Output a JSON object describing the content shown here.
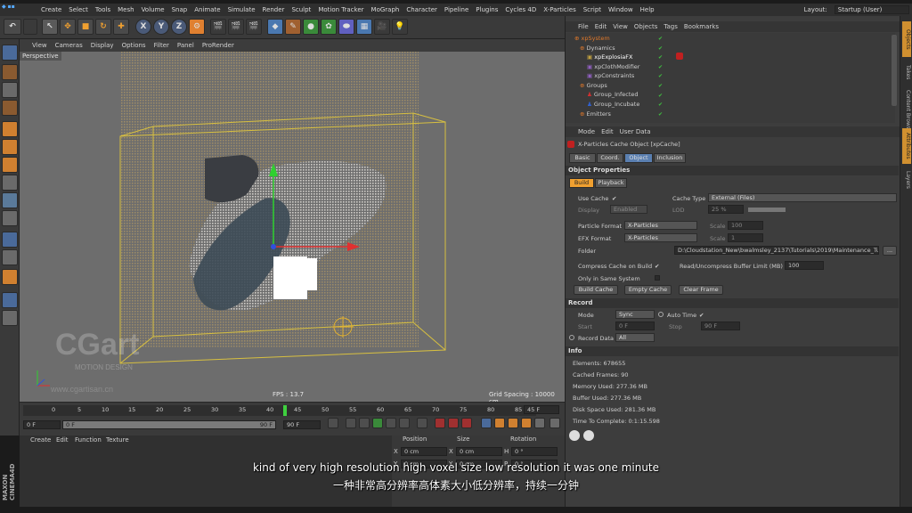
{
  "window_title": "CINEMA 4D",
  "menubar": {
    "items": [
      "Create",
      "Select",
      "Tools",
      "Mesh",
      "Volume",
      "Snap",
      "Animate",
      "Simulate",
      "Render",
      "Sculpt",
      "Motion Tracker",
      "MoGraph",
      "Character",
      "Pipeline",
      "Plugins",
      "Cycles 4D",
      "X-Particles",
      "Script",
      "Window",
      "Help"
    ],
    "layout_label": "Layout:",
    "layout_value": "Startup (User)"
  },
  "toolbar": {
    "x_label": "X",
    "y_label": "Y",
    "z_label": "Z"
  },
  "viewport": {
    "menu": [
      "View",
      "Cameras",
      "Display",
      "Options",
      "Filter",
      "Panel",
      "ProRender"
    ],
    "label": "Perspective",
    "fps": "FPS : 13.7",
    "grid_spacing": "Grid Spacing : 10000 cm",
    "watermark_big": "CGart",
    "watermark_small": "MOTION DESIGN",
    "watermark_url": "www.cgartisan.cn"
  },
  "timeline": {
    "ticks": [
      "0",
      "5",
      "10",
      "15",
      "20",
      "25",
      "30",
      "35",
      "40",
      "45",
      "50",
      "55",
      "60",
      "65",
      "70",
      "75",
      "80",
      "85",
      "90"
    ],
    "current_frame_box": "45 F",
    "start_field": "0 F",
    "start_field2": "0 F",
    "end_field": "90 F",
    "end_field2": "90 F",
    "playhead_frame": 45,
    "max_frame": 90
  },
  "bottom_panel": {
    "menu": [
      "Create",
      "Edit",
      "Function",
      "Texture"
    ],
    "coord_headers": [
      "Position",
      "Size",
      "Rotation"
    ],
    "rows": [
      {
        "axis": "X",
        "pos": "0 cm",
        "size_axis": "X",
        "size": "0 cm",
        "rot_axis": "H",
        "rot": "0 °"
      },
      {
        "axis": "Y",
        "pos": "0 cm",
        "size_axis": "Y",
        "size": "0 cm",
        "rot_axis": "P",
        "rot": "0 °"
      }
    ]
  },
  "object_manager": {
    "menu": [
      "File",
      "Edit",
      "View",
      "Objects",
      "Tags",
      "Bookmarks"
    ],
    "objects": [
      {
        "name": "xpSystem",
        "indent": 0,
        "color": "#e0782a"
      },
      {
        "name": "Dynamics",
        "indent": 1,
        "color": "#cfcfcf"
      },
      {
        "name": "xpExplosiaFX",
        "indent": 2,
        "color": "#ffffff"
      },
      {
        "name": "xpClothModifier",
        "indent": 2,
        "color": "#cfcfcf"
      },
      {
        "name": "xpConstraints",
        "indent": 2,
        "color": "#cfcfcf"
      },
      {
        "name": "Groups",
        "indent": 1,
        "color": "#cfcfcf"
      },
      {
        "name": "Group_Infected",
        "indent": 2,
        "color": "#cfcfcf"
      },
      {
        "name": "Group_Incubate",
        "indent": 2,
        "color": "#cfcfcf"
      },
      {
        "name": "Emitters",
        "indent": 1,
        "color": "#cfcfcf"
      }
    ]
  },
  "attributes": {
    "menu": [
      "Mode",
      "Edit",
      "User Data"
    ],
    "object_title": "X-Particles Cache Object [xpCache]",
    "tabs": [
      "Basic",
      "Coord.",
      "Object",
      "Inclusion"
    ],
    "active_tab": "Object",
    "section_object_properties": "Object Properties",
    "subtabs": [
      "Build",
      "Playback"
    ],
    "use_cache_label": "Use Cache",
    "use_cache_check": "✔",
    "cache_type_label": "Cache Type",
    "cache_type_value": "External (Files)",
    "display_label": "Display",
    "display_value": "Enabled",
    "lod_label": "LOD",
    "lod_value": "25 %",
    "particle_format_label": "Particle Format",
    "particle_format_value": "X-Particles",
    "efx_format_label": "EFX Format",
    "efx_format_value": "X-Particles",
    "scale_label": "Scale",
    "scale_value1": "100",
    "scale_value2": "1",
    "folder_label": "Folder",
    "folder_value": "D:\\Cloudstation_New\\bwalmsley_2137\\Tutorials\\2019\\Maintenance_Tutorials\\Mograpl",
    "folder_button": "...",
    "compress_label": "Compress Cache on Build",
    "compress_check": "✔",
    "buffer_label": "Read/Uncompress Buffer Limit (MB)",
    "buffer_value": "100",
    "only_same_label": "Only in Same System",
    "buttons": [
      "Build Cache",
      "Empty Cache",
      "Clear Frame"
    ],
    "section_record": "Record",
    "mode_label": "Mode",
    "mode_value": "Sync",
    "auto_time_label": "Auto Time",
    "auto_time_check": "✔",
    "start_label": "Start",
    "start_value": "0 F",
    "stop_label": "Stop",
    "stop_value": "90 F",
    "record_data_label": "Record Data",
    "record_data_value": "All",
    "section_info": "Info",
    "info": [
      "Elements: 678655",
      "Cached Frames: 90",
      "Memory Used: 277.36 MB",
      "Buffer Used: 277.36 MB",
      "Disk Space Used: 281.36 MB",
      "Time To Complete: 0:1:15.598"
    ]
  },
  "side_tabs": [
    "Objects",
    "Takes",
    "Content Browser",
    "Attributes",
    "Layers"
  ],
  "subtitles": {
    "english": "kind of very high resolution high voxel size low resolution it was one minute",
    "chinese": "一种非常高分辨率高体素大小低分辨率，持续一分钟"
  },
  "colors": {
    "accent_orange": "#f0a030",
    "active_tab_blue": "#5a7fb0",
    "viewport_bg": "#6d6d6d",
    "bbox_yellow": "#d8c040"
  }
}
